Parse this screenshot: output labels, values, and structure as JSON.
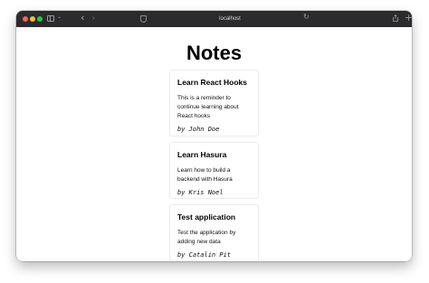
{
  "browser": {
    "url": "localhost",
    "icons": {
      "sidebar": "sidebar-icon",
      "chevron": "chevron-down-icon",
      "back": "back-arrow-icon",
      "forward": "forward-arrow-icon",
      "privacy": "shield-icon",
      "reload": "reload-icon",
      "share": "share-icon",
      "new_tab": "plus-icon",
      "tab_overview": "tab-overview-icon"
    }
  },
  "page": {
    "title": "Notes",
    "notes": [
      {
        "title": "Learn React Hooks",
        "body": "This is a reminder to continue learning about React hooks",
        "author": "by John Doe"
      },
      {
        "title": "Learn Hasura",
        "body": "Learn how to build a backend with Hasura",
        "author": "by Kris Noel"
      },
      {
        "title": "Test application",
        "body": "Test the application by adding new data",
        "author": "by Catalin Pit"
      }
    ]
  },
  "colors": {
    "toolbar": "#2b2b2d",
    "close": "#ff5f57",
    "minimize": "#febc2e",
    "zoom": "#28c840"
  }
}
